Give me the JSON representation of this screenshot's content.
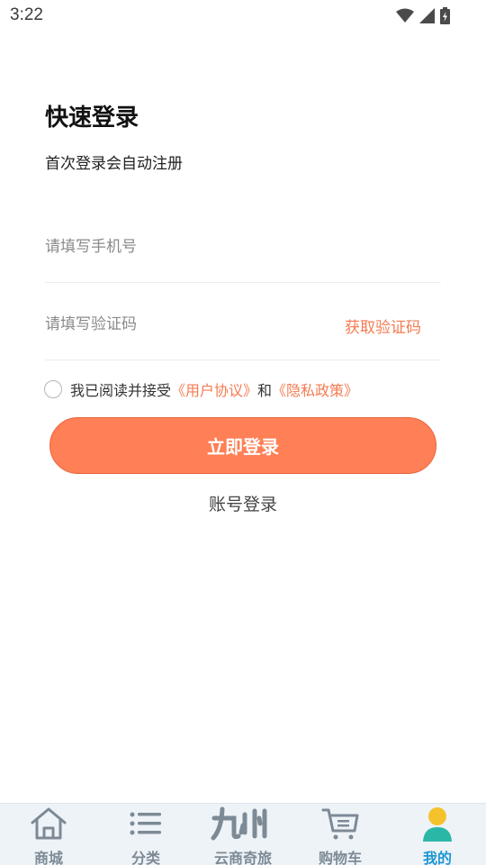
{
  "status_bar": {
    "time": "3:22"
  },
  "login": {
    "title": "快速登录",
    "subtitle": "首次登录会自动注册",
    "phone_placeholder": "请填写手机号",
    "code_placeholder": "请填写验证码",
    "get_code_label": "获取验证码",
    "agree_prefix": "我已阅读并接受",
    "user_agreement": "《用户协议》",
    "agree_and": "和",
    "privacy_policy": "《隐私政策》",
    "submit_label": "立即登录",
    "account_login_label": "账号登录"
  },
  "tabbar": {
    "items": [
      {
        "label": "商城",
        "icon": "home-icon"
      },
      {
        "label": "分类",
        "icon": "list-icon"
      },
      {
        "label": "云商奇旅",
        "icon": "jiuzhou-logo-icon"
      },
      {
        "label": "购物车",
        "icon": "cart-icon"
      },
      {
        "label": "我的",
        "icon": "person-icon"
      }
    ]
  },
  "colors": {
    "accent": "#ff7f56",
    "link": "#f47b52",
    "tab_inactive": "#7d8a96",
    "tab_active": "#1d97d4"
  }
}
